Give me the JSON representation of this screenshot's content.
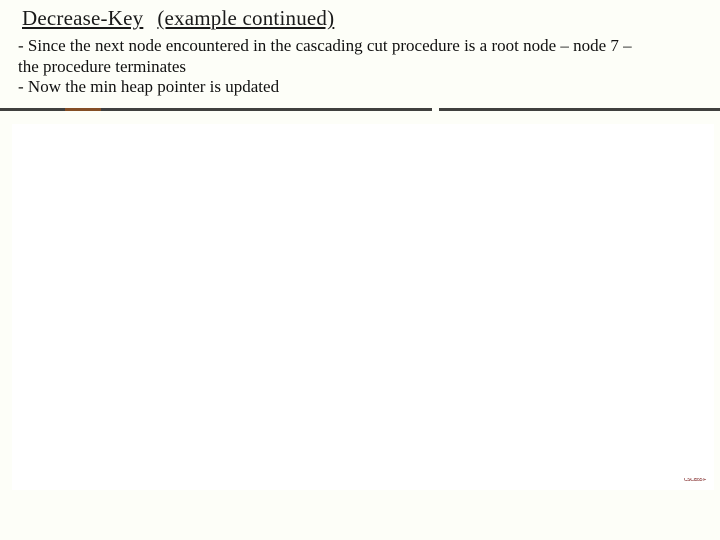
{
  "title": {
    "part1": "Decrease-Key",
    "part2": "(example continued)"
  },
  "body": {
    "line1": "- Since the next node encountered in the cascading cut procedure is a root node – node 7 –",
    "line2": "the procedure terminates",
    "line3": "- Now the min heap pointer is updated"
  },
  "credit": "CSCI555 F"
}
